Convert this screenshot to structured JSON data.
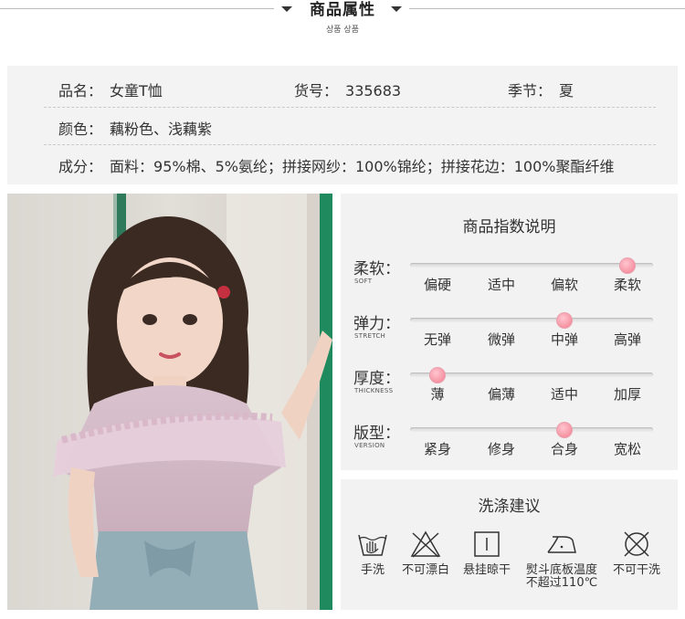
{
  "header": {
    "title": "商品属性",
    "subtitle": "상품 상품"
  },
  "attributes": {
    "name_key": "品名：",
    "name_val": "女童T恤",
    "sku_key": "货号：",
    "sku_val": "335683",
    "season_key": "季节：",
    "season_val": "夏",
    "color_key": "颜色：",
    "color_val": "藕粉色、浅藕紫",
    "material_key": "成分：",
    "material_val": "面料：95%棉、5%氨纶；拼接网纱：100%锦纶；拼接花边：100%聚酯纤维"
  },
  "photo": {
    "alt": "girl wearing pink ruffled T-shirt"
  },
  "index_panel": {
    "title": "商品指数说明",
    "rows": [
      {
        "label": "柔软：",
        "en": "SOFT",
        "options": [
          "偏硬",
          "适中",
          "偏软",
          "柔软"
        ],
        "selected": 3
      },
      {
        "label": "弹力：",
        "en": "STRETCH",
        "options": [
          "无弹",
          "微弹",
          "中弹",
          "高弹"
        ],
        "selected": 2
      },
      {
        "label": "厚度：",
        "en": "THICKNESS",
        "options": [
          "薄",
          "偏薄",
          "适中",
          "加厚"
        ],
        "selected": 0
      },
      {
        "label": "版型：",
        "en": "VERSION",
        "options": [
          "紧身",
          "修身",
          "合身",
          "宽松"
        ],
        "selected": 2
      }
    ]
  },
  "wash_panel": {
    "title": "洗涤建议",
    "items": [
      {
        "icon": "hand-wash-icon",
        "label": "手洗"
      },
      {
        "icon": "no-bleach-icon",
        "label": "不可漂白"
      },
      {
        "icon": "hang-dry-icon",
        "label": "悬挂晾干"
      },
      {
        "icon": "iron-icon",
        "label": "熨斗底板温度不超过110℃"
      },
      {
        "icon": "no-dry-clean-icon",
        "label": "不可干洗"
      }
    ]
  }
}
